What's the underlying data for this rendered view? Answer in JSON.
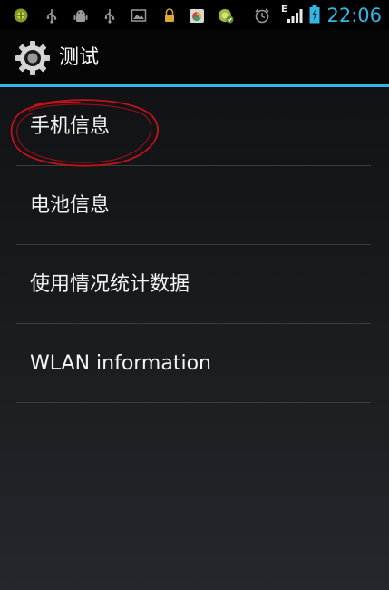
{
  "status_bar": {
    "time": "22:06",
    "network_type": "E",
    "time_color": "#33b5e5",
    "icons": [
      "notification-icon",
      "usb-icon",
      "android-debug-icon",
      "usb-icon",
      "image-icon",
      "lock-icon",
      "store-icon",
      "sync-icon",
      "alarm-icon",
      "signal-icon",
      "battery-charging-icon"
    ]
  },
  "action_bar": {
    "title": "测试",
    "icon": "settings-gear-icon",
    "divider_color": "#33b5e5"
  },
  "list": {
    "items": [
      {
        "label": "手机信息"
      },
      {
        "label": "电池信息"
      },
      {
        "label": "使用情况统计数据"
      },
      {
        "label": "WLAN information"
      }
    ]
  },
  "annotation": {
    "color": "#c0121a",
    "target": "手机信息"
  }
}
